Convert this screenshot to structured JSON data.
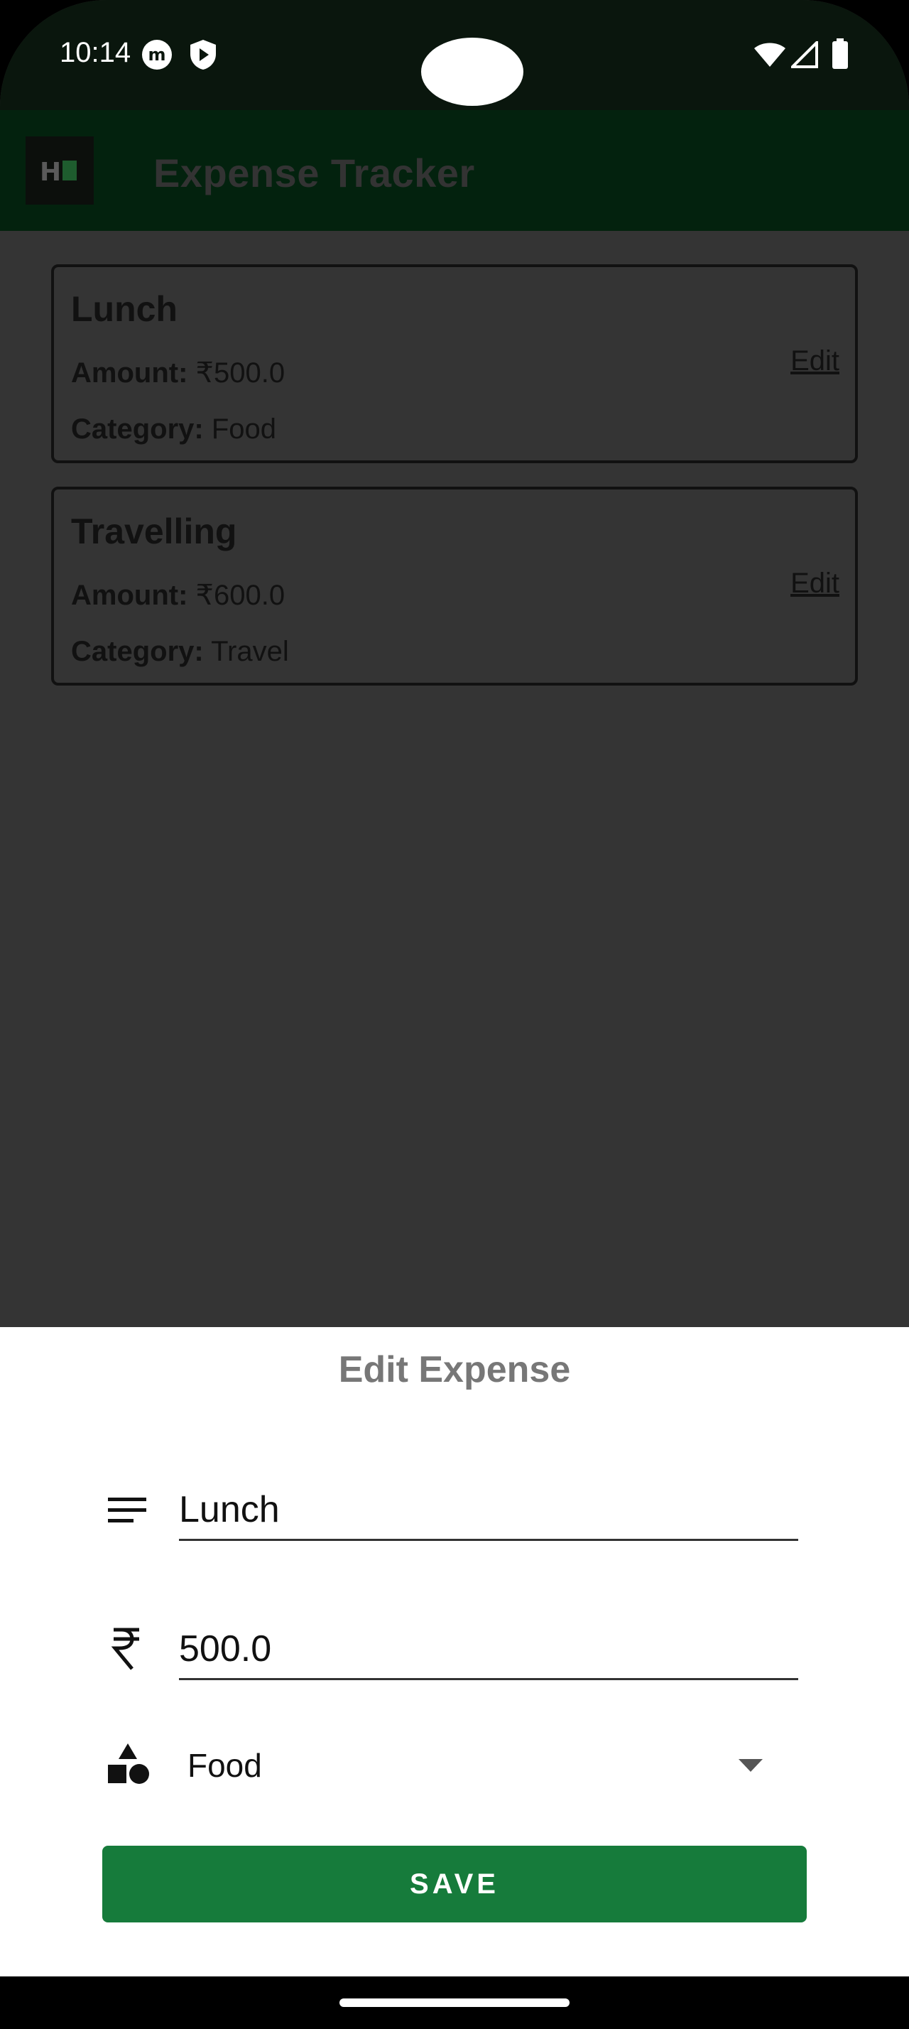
{
  "status_bar": {
    "time": "10:14",
    "icons": [
      "m-badge-icon",
      "shield-play-icon",
      "wifi-icon",
      "signal-icon",
      "battery-icon"
    ]
  },
  "app_bar": {
    "logo_text": "H",
    "title": "Expense Tracker"
  },
  "expenses": [
    {
      "name": "Lunch",
      "amount_label": "Amount:",
      "amount": "₹500.0",
      "category_label": "Category:",
      "category": "Food",
      "edit": "Edit"
    },
    {
      "name": "Travelling",
      "amount_label": "Amount:",
      "amount": "₹600.0",
      "category_label": "Category:",
      "category": "Travel",
      "edit": "Edit"
    }
  ],
  "dialog": {
    "title": "Edit Expense",
    "name_value": "Lunch",
    "amount_value": "500.0",
    "category_value": "Food",
    "save_label": "SAVE"
  },
  "colors": {
    "app_bar": "#03220e",
    "accent_button": "#167b3b",
    "scrim": "#343434"
  }
}
